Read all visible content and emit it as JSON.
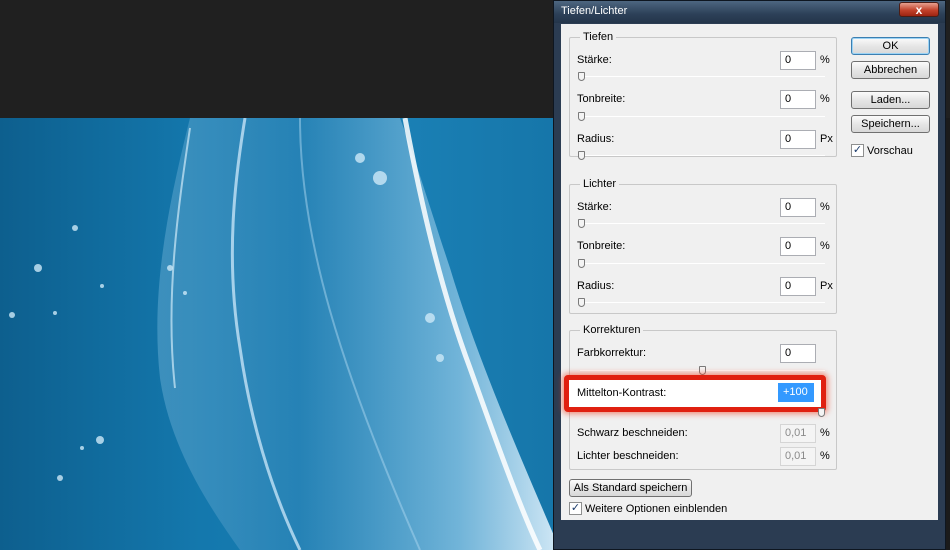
{
  "dialog": {
    "title": "Tiefen/Lichter",
    "close_glyph": "x"
  },
  "tiefen": {
    "legend": "Tiefen",
    "staerke_label": "Stärke:",
    "staerke_value": "0",
    "staerke_unit": "%",
    "tonbreite_label": "Tonbreite:",
    "tonbreite_value": "0",
    "tonbreite_unit": "%",
    "radius_label": "Radius:",
    "radius_value": "0",
    "radius_unit": "Px"
  },
  "lichter": {
    "legend": "Lichter",
    "staerke_label": "Stärke:",
    "staerke_value": "0",
    "staerke_unit": "%",
    "tonbreite_label": "Tonbreite:",
    "tonbreite_value": "0",
    "tonbreite_unit": "%",
    "radius_label": "Radius:",
    "radius_value": "0",
    "radius_unit": "Px"
  },
  "korrekturen": {
    "legend": "Korrekturen",
    "farbkorrektur_label": "Farbkorrektur:",
    "farbkorrektur_value": "0",
    "mittelton_label": "Mittelton-Kontrast:",
    "mittelton_value": "+100",
    "schwarz_label": "Schwarz beschneiden:",
    "schwarz_value": "0,01",
    "schwarz_unit": "%",
    "lichter_label": "Lichter beschneiden:",
    "lichter_value": "0,01",
    "lichter_unit": "%"
  },
  "buttons": {
    "ok": "OK",
    "abbrechen": "Abbrechen",
    "laden": "Laden...",
    "speichern": "Speichern...",
    "standard": "Als Standard speichern"
  },
  "checkboxes": {
    "vorschau_label": "Vorschau",
    "vorschau_checked": true,
    "weitere_label": "Weitere Optionen einblenden",
    "weitere_checked": true,
    "check_glyph": "✓"
  },
  "colors": {
    "highlight": "#e02010",
    "selection": "#3399ff",
    "photo_blue": "#1478ad"
  }
}
